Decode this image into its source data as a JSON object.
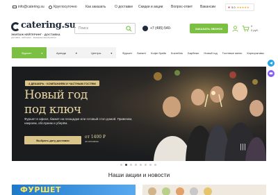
{
  "topbar": {
    "email": "info@catering.su",
    "hours": "Круглосуточно",
    "links": [
      "Как заказать",
      "О доставке",
      "Скидки и акции",
      "Вопрос-ответ",
      "Вакансии"
    ],
    "rating_value": "5.0",
    "rating_stars": "★★★★★"
  },
  "header": {
    "logo_text": "catering.su",
    "tagline": "ЭКИПАЖ КЕЙТЕРИНГ · ДОСТАВКА",
    "tagline_sub": "доставка · кейтеринг · выездные мероприятия",
    "search_placeholder": "Поиск",
    "phone": "+7 (495) 540-",
    "call_button": "ЗАКАЗАТЬ ЗВОНОК",
    "cart_count": "0",
    "cart_sum": "0 руб."
  },
  "nav": {
    "delivery_label": "ДОСТАВКА ЕДЫ",
    "service_label": "ВЫЕЗДНОЕ ОБСЛУЖИВАНИЕ",
    "dropdowns": [
      "Фуршет",
      "Аренда",
      "Центры"
    ],
    "categories": [
      "Фуршет",
      "Банкет",
      "Кофе брейк",
      "Коктейль",
      "Барбекю",
      "Новый год",
      "Гостевые меню",
      "Корпоративы"
    ]
  },
  "hero": {
    "badge": "4 ДЕКАБРЬ · КОМПАНИЯМ И ЧАСТНЫМ ГОСТЯМ",
    "title_line1": "Новый год",
    "title_line2": "под ключ",
    "description": "Фуршет в офисе, банкет на площадке или готовый стол домой. Привезем, накроем, обслужим и уберём.",
    "button": "Выбрать дату доставки",
    "price": "от 1400 ₽",
    "price_note": "за человека",
    "slide_count": 8,
    "active_slide": 1
  },
  "promo": {
    "section_title": "Наши акции и новости",
    "card1_text": "ФУРШЕТ"
  },
  "colors": {
    "accent_green": "#7bc043",
    "hero_gold": "#d9c48a",
    "dark": "#1f2a3a",
    "telegram": "#2aa3e0",
    "chat": "#8a5cf6"
  }
}
